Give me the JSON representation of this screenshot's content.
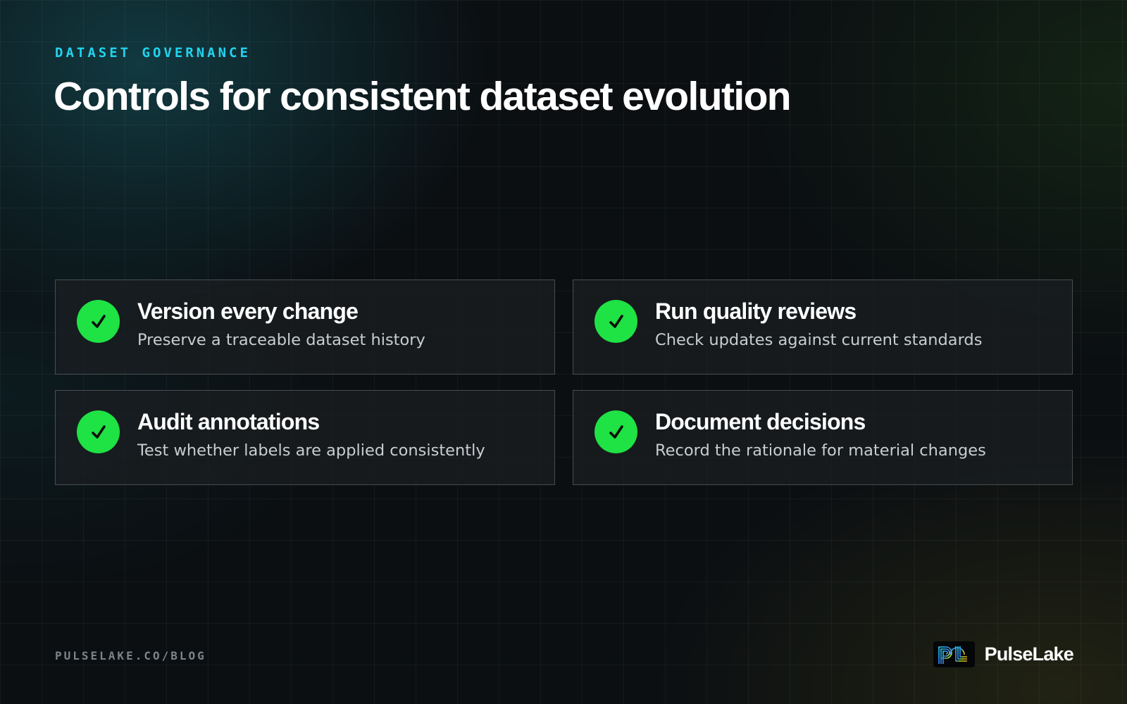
{
  "eyebrow": "DATASET GOVERNANCE",
  "title": "Controls for consistent dataset evolution",
  "cards": [
    {
      "icon": "check-icon",
      "title": "Version every change",
      "description": "Preserve a traceable dataset history"
    },
    {
      "icon": "check-icon",
      "title": "Run quality reviews",
      "description": "Check updates against current standards"
    },
    {
      "icon": "check-icon",
      "title": "Audit annotations",
      "description": "Test whether labels are applied consistently"
    },
    {
      "icon": "check-icon",
      "title": "Document decisions",
      "description": "Record the rationale for material changes"
    }
  ],
  "footer": {
    "url": "PULSELAKE.CO/BLOG",
    "brand_name": "PulseLake",
    "logo_icon": "pulselake-logo-icon"
  },
  "colors": {
    "accent": "#22d3ee",
    "check": "#1fe244",
    "background": "#0b0f12"
  }
}
